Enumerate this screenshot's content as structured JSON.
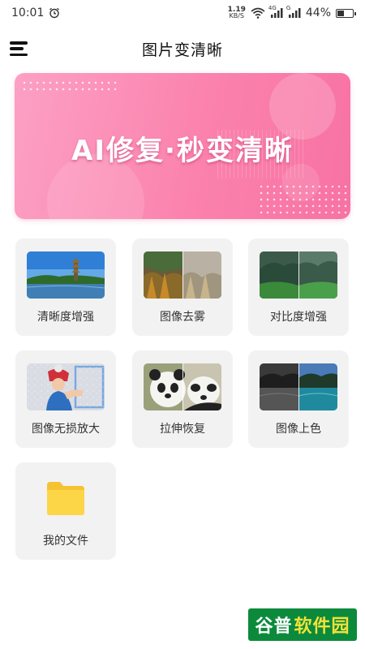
{
  "status_bar": {
    "time": "10:01",
    "net_speed_value": "1.19",
    "net_speed_unit": "KB/S",
    "sig1_tag": "4G",
    "sig2_tag": "G",
    "battery_percent": "44%",
    "battery_level": 0.44
  },
  "header": {
    "title": "图片变清晰",
    "menu_icon": "hamburger-menu-icon"
  },
  "banner": {
    "text": "AI修复·秒变清晰",
    "colors": {
      "start": "#fca0c4",
      "end": "#f772a3"
    }
  },
  "features": [
    {
      "label": "清晰度增强",
      "icon": "pagoda-lake-thumbnail"
    },
    {
      "label": "图像去雾",
      "icon": "dehaze-forest-thumbnail"
    },
    {
      "label": "对比度增强",
      "icon": "contrast-valley-thumbnail"
    },
    {
      "label": "图像无损放大",
      "icon": "upscale-child-thumbnail"
    },
    {
      "label": "拉伸恢复",
      "icon": "panda-stretch-thumbnail"
    },
    {
      "label": "图像上色",
      "icon": "colorize-lake-thumbnail"
    },
    {
      "label": "我的文件",
      "icon": "folder-icon"
    }
  ],
  "watermark": {
    "part1": "谷普",
    "part2": "软件园"
  }
}
